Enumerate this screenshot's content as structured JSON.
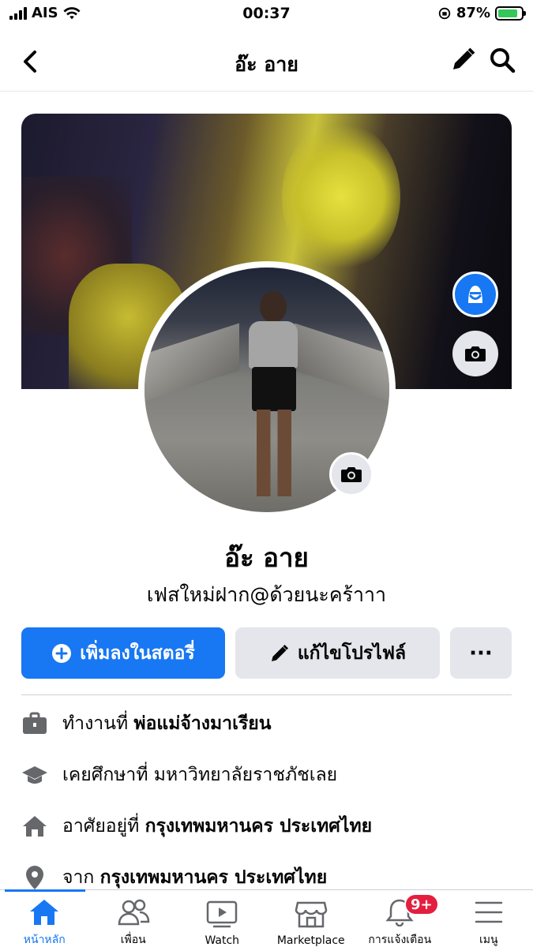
{
  "status_bar": {
    "carrier": "AIS",
    "time": "00:37",
    "battery_percent": "87%",
    "battery_level": 0.87
  },
  "nav": {
    "title": "อ๊ะ อาย",
    "back_icon": "chevron-left-icon",
    "edit_icon": "pencil-icon",
    "search_icon": "search-icon"
  },
  "profile": {
    "name": "อ๊ะ อาย",
    "bio": "เฟสใหม่ฝาก@ด้วยนะคร้าาา"
  },
  "actions": {
    "add_story_label": "เพิ่มลงในสตอรี่",
    "edit_profile_label": "แก้ไขโปรไฟล์",
    "more_label": "···"
  },
  "info": [
    {
      "icon": "briefcase-icon",
      "label": "ทำงานที่",
      "value": "พ่อแม่จ้างมาเรียน"
    },
    {
      "icon": "graduation-cap-icon",
      "label": "เคยศึกษาที่ มหาวิทยาลัยราชภัชเลย",
      "value": ""
    },
    {
      "icon": "home-icon",
      "label": "อาศัยอยู่ที่",
      "value": "กรุงเทพมหานคร ประเทศไทย"
    },
    {
      "icon": "location-pin-icon",
      "label": "จาก",
      "value": "กรุงเทพมหานคร ประเทศไทย"
    }
  ],
  "tabs": [
    {
      "label": "หน้าหลัก",
      "icon": "home-icon",
      "active": true
    },
    {
      "label": "เพื่อน",
      "icon": "friends-icon",
      "active": false
    },
    {
      "label": "Watch",
      "icon": "watch-icon",
      "active": false
    },
    {
      "label": "Marketplace",
      "icon": "marketplace-icon",
      "active": false
    },
    {
      "label": "การแจ้งเตือน",
      "icon": "bell-icon",
      "active": false,
      "badge": "9+"
    },
    {
      "label": "เมนู",
      "icon": "menu-icon",
      "active": false
    }
  ],
  "colors": {
    "accent": "#1877f2",
    "badge": "#e41e3f",
    "button_gray": "#e4e6eb"
  }
}
